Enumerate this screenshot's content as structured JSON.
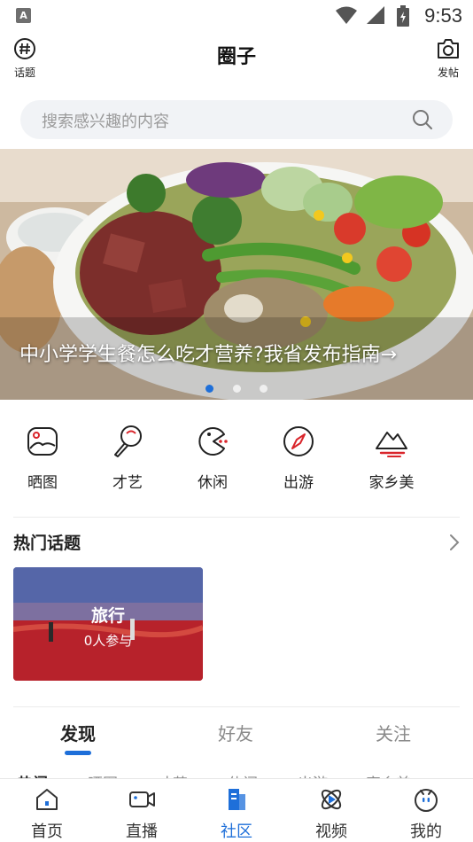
{
  "status_bar": {
    "notification_letter": "A",
    "time": "9:53"
  },
  "header": {
    "title": "圈子",
    "left_button_label": "话题",
    "right_button_label": "发帖"
  },
  "search": {
    "placeholder": "搜索感兴趣的内容"
  },
  "banner": {
    "caption": "中小学学生餐怎么吃才营养?我省发布指南→",
    "slide_count": 3,
    "active_slide": 0
  },
  "categories": [
    {
      "label": "晒图",
      "icon": "photo-icon"
    },
    {
      "label": "才艺",
      "icon": "talent-icon"
    },
    {
      "label": "休闲",
      "icon": "leisure-icon"
    },
    {
      "label": "出游",
      "icon": "compass-icon"
    },
    {
      "label": "家乡美",
      "icon": "mountain-icon"
    }
  ],
  "hot_topics": {
    "title": "热门话题",
    "cards": [
      {
        "title": "旅行",
        "subtitle": "0人参与"
      }
    ]
  },
  "feed_tabs": [
    {
      "label": "发现",
      "active": true
    },
    {
      "label": "好友",
      "active": false
    },
    {
      "label": "关注",
      "active": false
    }
  ],
  "sub_tabs": [
    "热门",
    "晒图",
    "才艺",
    "休闲",
    "出游",
    "家乡美"
  ],
  "bottom_nav": [
    {
      "label": "首页",
      "icon": "home-icon",
      "active": false
    },
    {
      "label": "直播",
      "icon": "live-icon",
      "active": false
    },
    {
      "label": "社区",
      "icon": "community-icon",
      "active": true
    },
    {
      "label": "视频",
      "icon": "video-icon",
      "active": false
    },
    {
      "label": "我的",
      "icon": "profile-icon",
      "active": false
    }
  ],
  "colors": {
    "accent": "#1e6fd9",
    "icon_red": "#d9252b"
  }
}
